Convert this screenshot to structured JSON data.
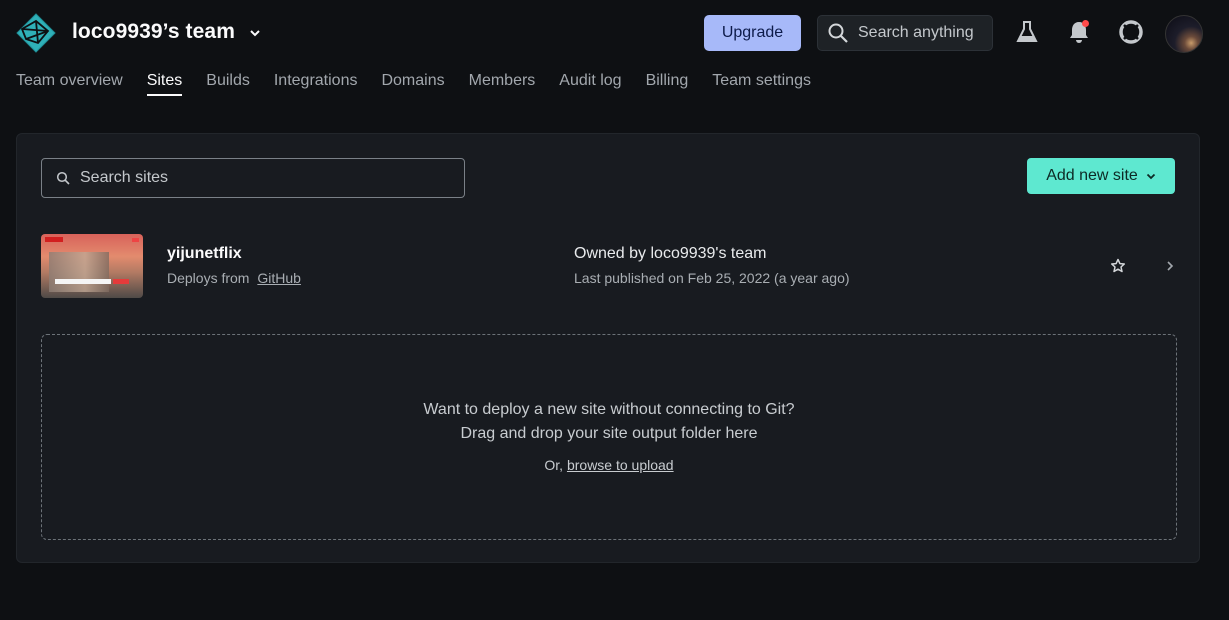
{
  "header": {
    "team_name": "loco9939’s team",
    "upgrade_label": "Upgrade",
    "search_placeholder": "Search anything",
    "icons": [
      "netlify-logo-icon",
      "chevron-down-icon",
      "search-icon",
      "flask-icon",
      "bell-icon",
      "lifebuoy-icon",
      "avatar"
    ],
    "notification_dot_color": "#ff4a4a"
  },
  "nav": {
    "tabs": [
      {
        "label": "Team overview"
      },
      {
        "label": "Sites",
        "active": true
      },
      {
        "label": "Builds"
      },
      {
        "label": "Integrations"
      },
      {
        "label": "Domains"
      },
      {
        "label": "Members"
      },
      {
        "label": "Audit log"
      },
      {
        "label": "Billing"
      },
      {
        "label": "Team settings"
      }
    ]
  },
  "sites_panel": {
    "search_placeholder": "Search sites",
    "search_value": "",
    "add_site_label": "Add new site",
    "accent_color": "#5ee8d0",
    "sites": [
      {
        "name": "yijunetflix",
        "deploys_prefix": "Deploys from",
        "deploys_source": "GitHub",
        "owner": "Owned by loco9939's team",
        "published": "Last published on Feb 25, 2022 (a year ago)"
      }
    ],
    "dropzone": {
      "line1": "Want to deploy a new site without connecting to Git?",
      "line2": "Drag and drop your site output folder here",
      "or_prefix": "Or,",
      "browse_label": "browse to upload"
    }
  }
}
